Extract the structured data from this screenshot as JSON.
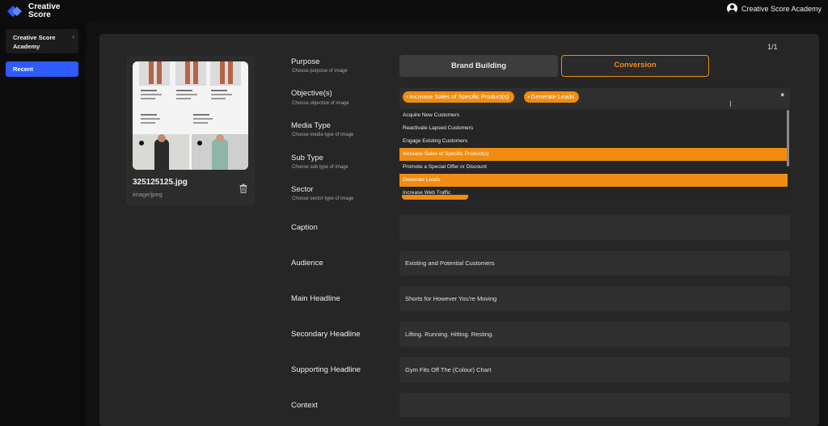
{
  "brand": {
    "name": "Creative Score"
  },
  "account": {
    "name": "Creative Score Academy"
  },
  "sidebar": {
    "workspace_label": "Creative Score Academy",
    "recent_label": "Recent"
  },
  "pager": "1/1",
  "image": {
    "filename": "325125125.jpg",
    "mimetype": "image/jpeg"
  },
  "form": {
    "purpose": {
      "label": "Purpose",
      "help": "Choose purpose of image",
      "options": [
        "Brand Building",
        "Conversion"
      ],
      "selected": "Conversion"
    },
    "objectives": {
      "label": "Objective(s)",
      "help": "Choose objective of image",
      "chips": [
        "Increase Sales of Specific Product(s)",
        "Generate Leads"
      ],
      "options": [
        "Acquire New Customers",
        "Reactivate Lapsed Customers",
        "Engage Existing Customers",
        "Increase Sales of Specific Product(s)",
        "Promote a Special Offer or Discount",
        "Generate Leads",
        "Increase Web Traffic"
      ]
    },
    "media_type": {
      "label": "Media Type",
      "help": "Choose media type of image"
    },
    "sub_type": {
      "label": "Sub Type",
      "help": "Choose sub type of image"
    },
    "sector": {
      "label": "Sector",
      "help": "Choose sector type of image"
    },
    "caption": {
      "label": "Caption",
      "value": ""
    },
    "audience": {
      "label": "Audience",
      "value": "Existing and Potential Customers"
    },
    "main_headline": {
      "label": "Main Headline",
      "value": "Shorts for However You're Moving"
    },
    "secondary_headline": {
      "label": "Secondary Headline",
      "value": "Lifting. Running. Hitting. Resting."
    },
    "supporting_headline": {
      "label": "Supporting Headline",
      "value": "Gym Fits Off The (Colour) Chart"
    },
    "context": {
      "label": "Context",
      "value": ""
    }
  },
  "colors": {
    "accent": "#f08c10",
    "brand_blue": "#2e5bff",
    "panel": "#262626"
  }
}
